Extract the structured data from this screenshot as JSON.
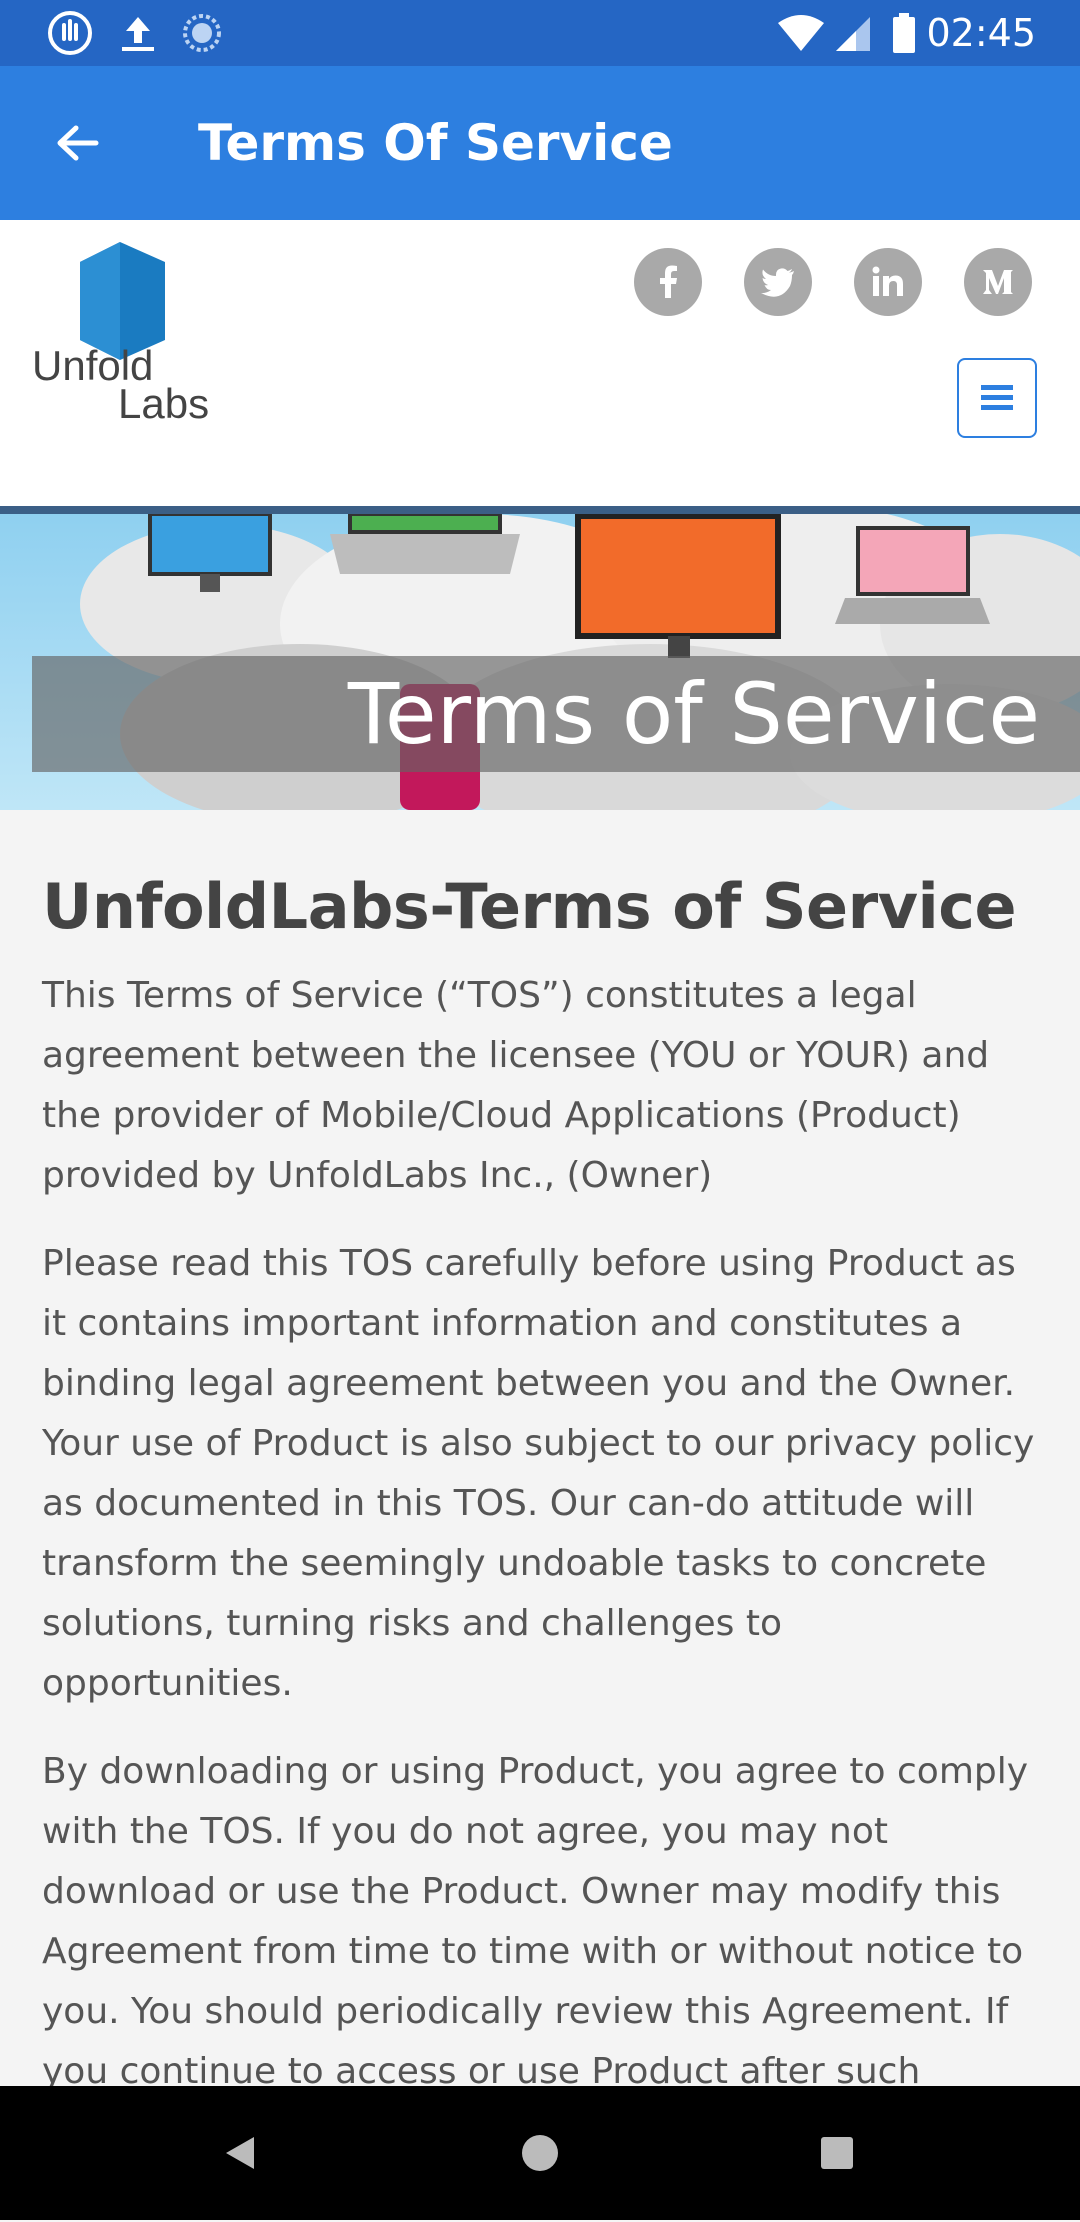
{
  "status_bar": {
    "time": "02:45",
    "icons": [
      "hand-touch-icon",
      "upload-icon",
      "sync-icon",
      "wifi-icon",
      "signal-icon",
      "battery-icon"
    ]
  },
  "app_bar": {
    "title": "Terms Of Service",
    "back_icon": "arrow-left-icon",
    "color": "#2d7fe0"
  },
  "site_header": {
    "logo_text_line1": "Unfold",
    "logo_text_line2": "Labs",
    "social_icons": [
      "facebook-icon",
      "twitter-icon",
      "linkedin-icon",
      "medium-icon"
    ],
    "menu_icon": "hamburger-menu-icon"
  },
  "banner": {
    "title": "Terms of Service"
  },
  "content": {
    "heading": "UnfoldLabs-Terms of Service",
    "paragraphs": [
      "This Terms of Service (“TOS”) constitutes a legal agreement between the licensee (YOU or YOUR) and the provider of Mobile/Cloud Applications (Product) provided by UnfoldLabs Inc., (Owner)",
      "Please read this TOS carefully before using Product as it contains important information and constitutes a binding legal agreement between you and the Owner. Your use of Product is also subject to our privacy policy as documented in this TOS. Our can-do attitude will transform the seemingly undoable tasks to concrete solutions, turning risks and challenges to opportunities.",
      "By downloading or using Product, you agree to comply with the TOS. If you do not agree, you may not download or use the Product. Owner may modify this Agreement from time to time with or without notice to you. You should periodically review this Agreement. If you continue to access or use Product after such modification, you will be deemed to have read, understood and unconditionally"
    ]
  },
  "nav_bar": {
    "buttons": [
      "back-triangle-icon",
      "home-circle-icon",
      "recents-square-icon"
    ]
  }
}
